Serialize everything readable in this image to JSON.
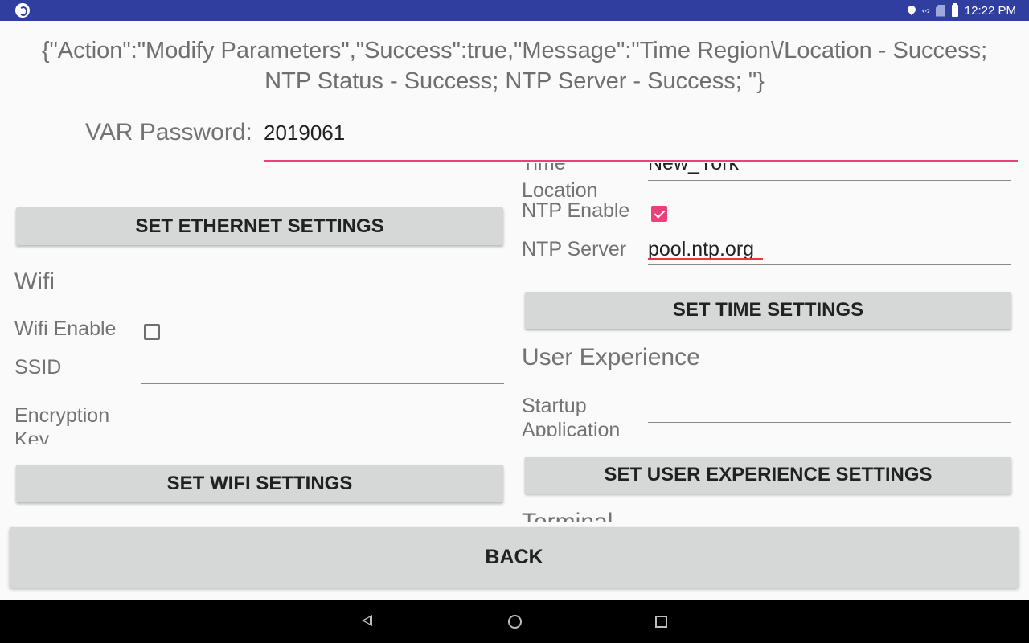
{
  "status_bar": {
    "time": "12:22 PM",
    "icons": [
      "location-icon",
      "data-transfer-icon",
      "no-sim-icon",
      "battery-icon"
    ]
  },
  "message": "{\"Action\":\"Modify Parameters\",\"Success\":true,\"Message\":\"Time Region\\/Location - Success; NTP Status - Success; NTP Server - Success; \"}",
  "password": {
    "label": "VAR Password:",
    "value": "2019061"
  },
  "left": {
    "ethernet_button": "SET ETHERNET SETTINGS",
    "wifi_section": "Wifi",
    "wifi_enable_label": "Wifi Enable",
    "wifi_enabled": false,
    "ssid_label": "SSID",
    "ssid_value": "",
    "encryption_label_1": "Encryption",
    "encryption_label_2": "Key",
    "encryption_value": "",
    "wifi_button": "SET WIFI SETTINGS"
  },
  "right": {
    "time_label_1": "Time",
    "time_label_2": "Location",
    "time_location_value": "New_York",
    "ntp_enable_label": "NTP Enable",
    "ntp_enabled": true,
    "ntp_server_label": "NTP Server",
    "ntp_server_value": "pool.ntp.org",
    "time_button": "SET TIME SETTINGS",
    "ux_section": "User Experience",
    "startup_label_1": "Startup",
    "startup_label_2": "Application",
    "startup_value": "",
    "ux_button": "SET USER EXPERIENCE SETTINGS",
    "terminal_section": "Terminal"
  },
  "back_button": "BACK",
  "accent_color": "#ec407a",
  "statusbar_color": "#303f9f"
}
